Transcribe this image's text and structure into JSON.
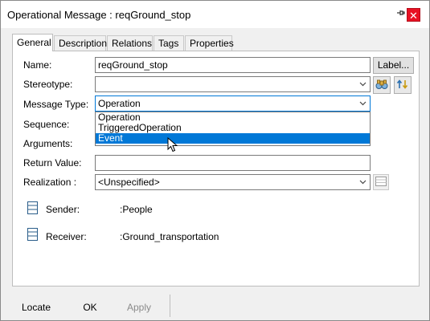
{
  "window": {
    "title": "Operational Message : reqGround_stop",
    "pin_glyph": "📌",
    "close_glyph": "✕"
  },
  "tabs": [
    {
      "label": "General"
    },
    {
      "label": "Description"
    },
    {
      "label": "Relations"
    },
    {
      "label": "Tags"
    },
    {
      "label": "Properties"
    }
  ],
  "form": {
    "name_label": "Name:",
    "name_value": "reqGround_stop",
    "label_button": "Label...",
    "stereotype_label": "Stereotype:",
    "stereotype_value": "",
    "message_type_label": "Message Type:",
    "message_type_value": "Operation",
    "message_type_options": [
      "Operation",
      "TriggeredOperation",
      "Event"
    ],
    "sequence_label": "Sequence:",
    "arguments_label": "Arguments:",
    "return_value_label": "Return Value:",
    "return_value": "",
    "realization_label": "Realization :",
    "realization_value": "<Unspecified>",
    "sender_label": "Sender:",
    "sender_value": ":People",
    "receiver_label": "Receiver:",
    "receiver_value": ":Ground_transportation"
  },
  "footer": {
    "locate": "Locate",
    "ok": "OK",
    "apply": "Apply"
  },
  "icons": {
    "chevron": "⌵",
    "binoculars": "binoculars-icon",
    "sort": "sort-arrows-icon",
    "browse": "browse-icon",
    "class": "class-box-icon"
  },
  "colors": {
    "selection": "#0078d7",
    "close": "#e81123"
  }
}
